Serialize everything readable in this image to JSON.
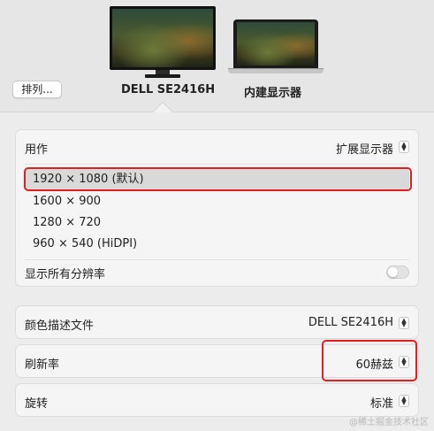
{
  "header": {
    "arrange_label": "排列...",
    "displays": [
      {
        "label": "DELL SE2416H",
        "type": "external-monitor",
        "selected": true
      },
      {
        "label": "内建显示器",
        "type": "laptop",
        "selected": false
      }
    ]
  },
  "display_settings": {
    "use_as": {
      "label": "用作",
      "value": "扩展显示器"
    },
    "resolutions": [
      {
        "label": "1920 × 1080 (默认)",
        "selected": true
      },
      {
        "label": "1600 × 900",
        "selected": false
      },
      {
        "label": "1280 × 720",
        "selected": false
      },
      {
        "label": "960 × 540 (HiDPI)",
        "selected": false
      }
    ],
    "show_all_resolutions": {
      "label": "显示所有分辨率",
      "enabled": false
    }
  },
  "color_profile": {
    "label": "颜色描述文件",
    "value": "DELL SE2416H"
  },
  "refresh_rate": {
    "label": "刷新率",
    "value": "60赫兹"
  },
  "rotation": {
    "label": "旋转",
    "value": "标准"
  },
  "watermark": "@稀土掘金技术社区",
  "colors": {
    "highlight": "#e02020",
    "selected_row": "#d9d9d9"
  },
  "icons": {
    "stepper": "up-down-chevron-icon"
  }
}
